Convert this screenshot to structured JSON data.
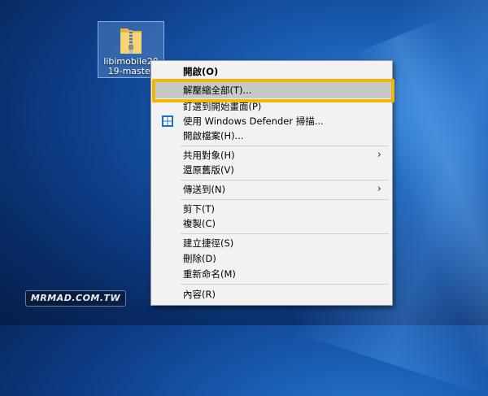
{
  "desktop_icon": {
    "label": "libimobile20\n19-master",
    "icon": "zip-folder-icon"
  },
  "context_menu": {
    "items": [
      {
        "label": "開啟(O)"
      },
      {
        "label": "解壓縮全部(T)..."
      },
      {
        "label": "釘選到開始畫面(P)"
      },
      {
        "label": "使用 Windows Defender 掃描...",
        "icon": "windows-defender-shield-icon"
      },
      {
        "label": "開啟檔案(H)..."
      },
      {
        "label": "共用對象(H)",
        "submenu": true
      },
      {
        "label": "還原舊版(V)"
      },
      {
        "label": "傳送到(N)",
        "submenu": true
      },
      {
        "label": "剪下(T)"
      },
      {
        "label": "複製(C)"
      },
      {
        "label": "建立捷徑(S)"
      },
      {
        "label": "刪除(D)"
      },
      {
        "label": "重新命名(M)"
      },
      {
        "label": "內容(R)"
      }
    ],
    "submenu_arrow": "›",
    "highlight_color": "#f6b600"
  },
  "watermark": {
    "text": "MRMAD.COM.TW"
  }
}
